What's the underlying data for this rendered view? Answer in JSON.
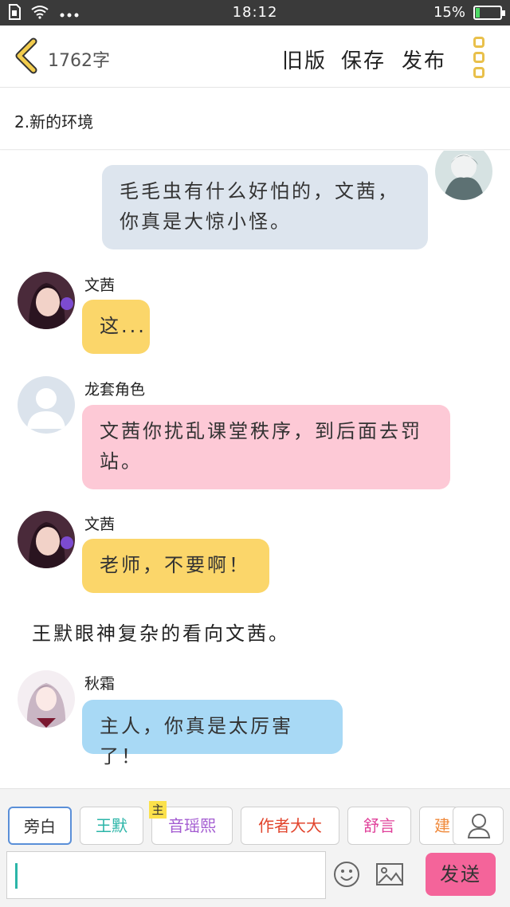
{
  "status_bar": {
    "time": "18:12",
    "battery": "15%",
    "battery_level": 0.15
  },
  "header": {
    "word_count": "1762字",
    "old_version_label": "旧版",
    "save_label": "保存",
    "publish_label": "发布"
  },
  "chapter": {
    "title": "2.新的环境"
  },
  "messages": [
    {
      "speaker": "",
      "text": "毛毛虫有什么好怕的，文茜，你真是大惊小怪。"
    },
    {
      "speaker": "文茜",
      "text": "这..."
    },
    {
      "speaker": "龙套角色",
      "text": "文茜你扰乱课堂秩序，到后面去罚站。"
    },
    {
      "speaker": "文茜",
      "text": "老师，不要啊！"
    },
    {
      "narration": "王默眼神复杂的看向文茜。"
    },
    {
      "speaker": "秋霜",
      "text": "主人，你真是太厉害了！"
    }
  ],
  "characters": [
    {
      "label": "旁白",
      "color": "#333333"
    },
    {
      "label": "王默",
      "color": "#2bb5a8"
    },
    {
      "label": "音瑶熙",
      "color": "#a35bd1",
      "badge": "主"
    },
    {
      "label": "作者大大",
      "color": "#e2452d"
    },
    {
      "label": "舒言",
      "color": "#e0409a"
    },
    {
      "label": "建",
      "color": "#f08a3c"
    }
  ],
  "composer": {
    "send_label": "发送",
    "input_value": ""
  },
  "colors": {
    "accent_yellow": "#e9c04b",
    "send_pink": "#f4649a",
    "bubble_gray": "#dde5ee",
    "bubble_yellow": "#fbd66a",
    "bubble_pink": "#fdc9d6",
    "bubble_blue": "#a8d9f5"
  }
}
